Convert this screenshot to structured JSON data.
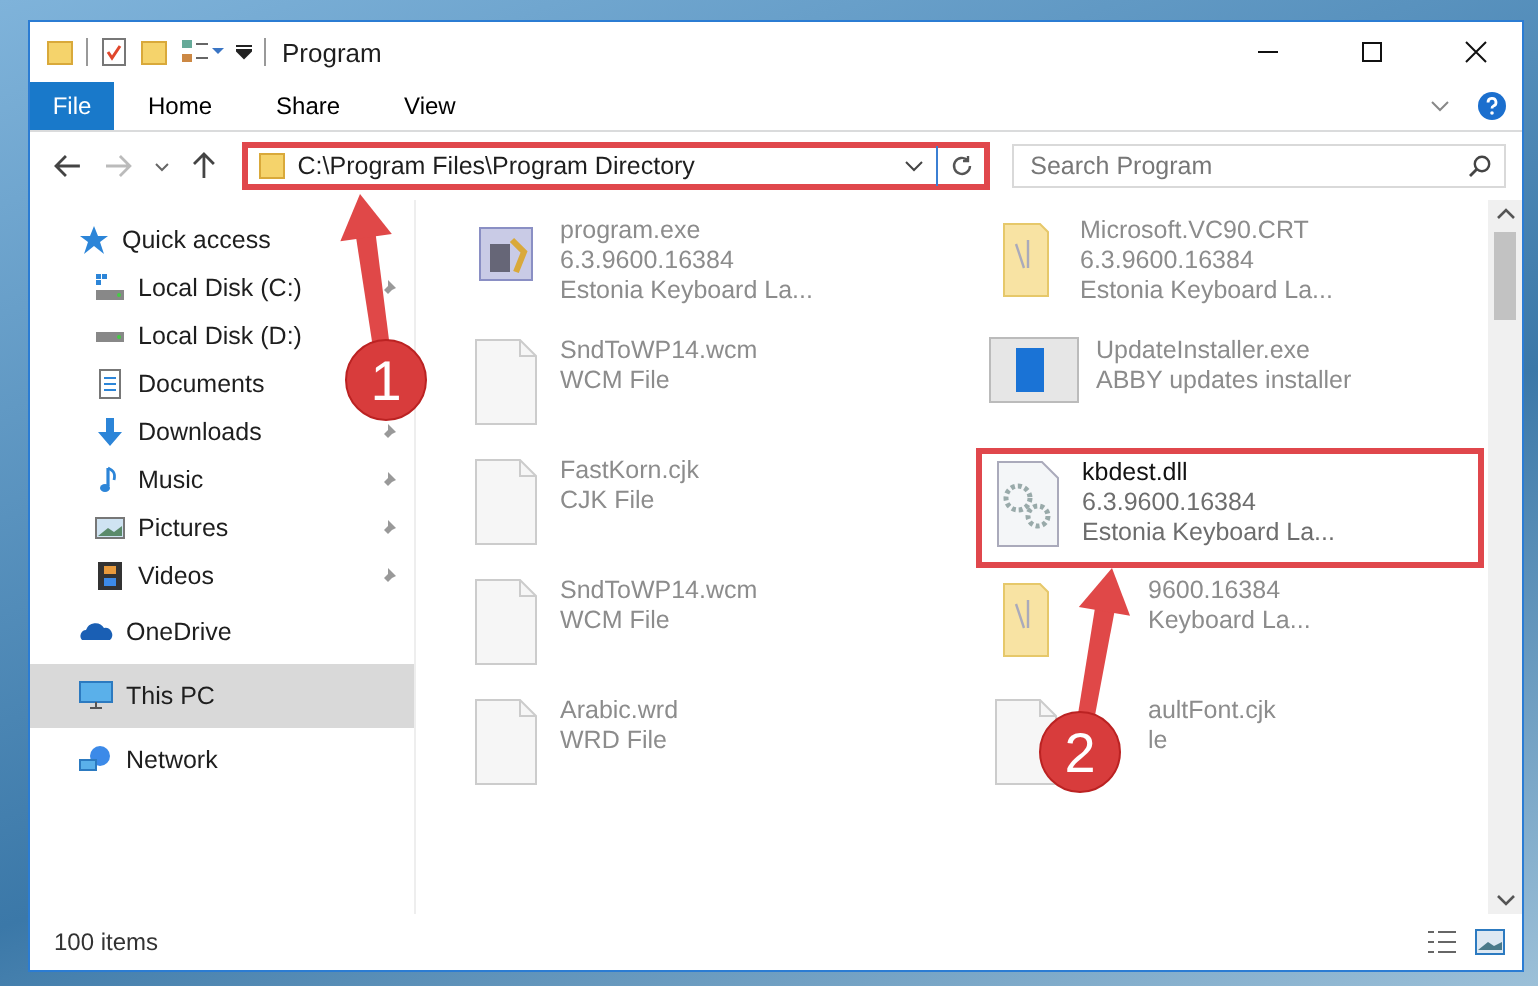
{
  "window": {
    "title": "Program"
  },
  "ribbon": {
    "tabs": [
      {
        "label": "File",
        "kind": "file"
      },
      {
        "label": "Home",
        "kind": "tab"
      },
      {
        "label": "Share",
        "kind": "tab"
      },
      {
        "label": "View",
        "kind": "tab"
      }
    ]
  },
  "address": {
    "path": "C:\\Program Files\\Program Directory",
    "annotated": true
  },
  "search": {
    "placeholder": "Search Program"
  },
  "sidebar": {
    "items": [
      {
        "label": "Quick access",
        "kind": "star",
        "pinned": false,
        "selected": false,
        "children": [
          {
            "label": "Local Disk (C:)",
            "kind": "sysdrive",
            "pinned": true,
            "selected": false
          },
          {
            "label": "Local Disk (D:)",
            "kind": "drive",
            "pinned": false,
            "selected": false
          },
          {
            "label": "Documents",
            "kind": "document",
            "pinned": false,
            "selected": false
          },
          {
            "label": "Downloads",
            "kind": "download",
            "pinned": true,
            "selected": false
          },
          {
            "label": "Music",
            "kind": "music",
            "pinned": true,
            "selected": false
          },
          {
            "label": "Pictures",
            "kind": "pictures",
            "pinned": true,
            "selected": false
          },
          {
            "label": "Videos",
            "kind": "videos",
            "pinned": true,
            "selected": false
          }
        ]
      },
      {
        "label": "OneDrive",
        "kind": "cloud",
        "pinned": false,
        "selected": false
      },
      {
        "label": "This PC",
        "kind": "pc",
        "pinned": false,
        "selected": true
      },
      {
        "label": "Network",
        "kind": "network",
        "pinned": false,
        "selected": false
      }
    ]
  },
  "files": [
    {
      "name": "program.exe",
      "lines": [
        "6.3.9600.16384",
        "Estonia Keyboard La..."
      ],
      "kind": "exe",
      "faded": true,
      "annotated": false
    },
    {
      "name": "Microsoft.VC90.CRT",
      "lines": [
        "6.3.9600.16384",
        "Estonia Keyboard La..."
      ],
      "kind": "folder",
      "faded": true,
      "annotated": false
    },
    {
      "name": "SndToWP14.wcm",
      "lines": [
        "WCM File"
      ],
      "kind": "blank",
      "faded": true,
      "annotated": false
    },
    {
      "name": "UpdateInstaller.exe",
      "lines": [
        "ABBY updates installer"
      ],
      "kind": "installer",
      "faded": true,
      "annotated": false
    },
    {
      "name": "FastKorn.cjk",
      "lines": [
        "CJK File"
      ],
      "kind": "blank",
      "faded": true,
      "annotated": false
    },
    {
      "name": "kbdest.dll",
      "lines": [
        "6.3.9600.16384",
        "Estonia Keyboard La..."
      ],
      "kind": "dll",
      "faded": false,
      "annotated": true
    },
    {
      "name": "SndToWP14.wcm",
      "lines": [
        "WCM File"
      ],
      "kind": "blank",
      "faded": true,
      "annotated": false
    },
    {
      "lines": [
        "9600.16384",
        "Keyboard La..."
      ],
      "kind": "folder",
      "faded": true,
      "annotated": false
    },
    {
      "name": "Arabic.wrd",
      "lines": [
        "WRD File"
      ],
      "kind": "blank",
      "faded": true,
      "annotated": false
    },
    {
      "name": "aultFont.cjk",
      "lines": [
        "le"
      ],
      "kind": "blank",
      "faded": true,
      "annotated": false
    }
  ],
  "annotations": [
    {
      "number": "1"
    },
    {
      "number": "2"
    }
  ],
  "status_bar": {
    "count": "100 items"
  }
}
